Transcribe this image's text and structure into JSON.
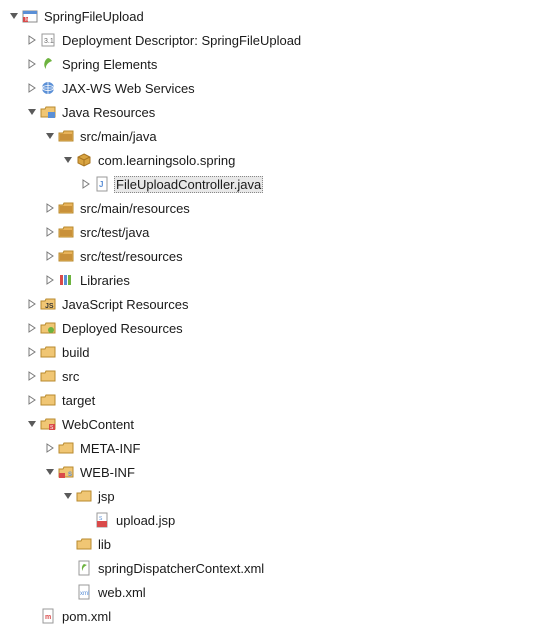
{
  "tree": [
    {
      "depth": 0,
      "arrow": "expanded",
      "icon": "project",
      "label": "SpringFileUpload",
      "selected": false
    },
    {
      "depth": 1,
      "arrow": "collapsed",
      "icon": "deployment-descriptor",
      "label": "Deployment Descriptor: SpringFileUpload",
      "selected": false
    },
    {
      "depth": 1,
      "arrow": "collapsed",
      "icon": "spring-elements",
      "label": "Spring Elements",
      "selected": false
    },
    {
      "depth": 1,
      "arrow": "collapsed",
      "icon": "jaxws",
      "label": "JAX-WS Web Services",
      "selected": false
    },
    {
      "depth": 1,
      "arrow": "expanded",
      "icon": "java-resources",
      "label": "Java Resources",
      "selected": false
    },
    {
      "depth": 2,
      "arrow": "expanded",
      "icon": "package-folder",
      "label": "src/main/java",
      "selected": false
    },
    {
      "depth": 3,
      "arrow": "expanded",
      "icon": "package",
      "label": "com.learningsolo.spring",
      "selected": false
    },
    {
      "depth": 4,
      "arrow": "collapsed",
      "icon": "java-file",
      "label": "FileUploadController.java",
      "selected": true
    },
    {
      "depth": 2,
      "arrow": "collapsed",
      "icon": "package-folder",
      "label": "src/main/resources",
      "selected": false
    },
    {
      "depth": 2,
      "arrow": "collapsed",
      "icon": "package-folder",
      "label": "src/test/java",
      "selected": false
    },
    {
      "depth": 2,
      "arrow": "collapsed",
      "icon": "package-folder",
      "label": "src/test/resources",
      "selected": false
    },
    {
      "depth": 2,
      "arrow": "collapsed",
      "icon": "libraries",
      "label": "Libraries",
      "selected": false
    },
    {
      "depth": 1,
      "arrow": "collapsed",
      "icon": "js-resources",
      "label": "JavaScript Resources",
      "selected": false
    },
    {
      "depth": 1,
      "arrow": "collapsed",
      "icon": "deployed-resources",
      "label": "Deployed Resources",
      "selected": false
    },
    {
      "depth": 1,
      "arrow": "collapsed",
      "icon": "folder",
      "label": "build",
      "selected": false
    },
    {
      "depth": 1,
      "arrow": "collapsed",
      "icon": "folder",
      "label": "src",
      "selected": false
    },
    {
      "depth": 1,
      "arrow": "collapsed",
      "icon": "folder",
      "label": "target",
      "selected": false
    },
    {
      "depth": 1,
      "arrow": "expanded",
      "icon": "web-content",
      "label": "WebContent",
      "selected": false
    },
    {
      "depth": 2,
      "arrow": "collapsed",
      "icon": "folder",
      "label": "META-INF",
      "selected": false
    },
    {
      "depth": 2,
      "arrow": "expanded",
      "icon": "web-inf",
      "label": "WEB-INF",
      "selected": false
    },
    {
      "depth": 3,
      "arrow": "expanded",
      "icon": "folder",
      "label": "jsp",
      "selected": false
    },
    {
      "depth": 4,
      "arrow": "none",
      "icon": "jsp-file",
      "label": "upload.jsp",
      "selected": false
    },
    {
      "depth": 3,
      "arrow": "none",
      "icon": "folder",
      "label": "lib",
      "selected": false
    },
    {
      "depth": 3,
      "arrow": "none",
      "icon": "xml-spring",
      "label": "springDispatcherContext.xml",
      "selected": false
    },
    {
      "depth": 3,
      "arrow": "none",
      "icon": "xml-file",
      "label": "web.xml",
      "selected": false
    },
    {
      "depth": 1,
      "arrow": "none",
      "icon": "maven-file",
      "label": "pom.xml",
      "selected": false
    }
  ]
}
